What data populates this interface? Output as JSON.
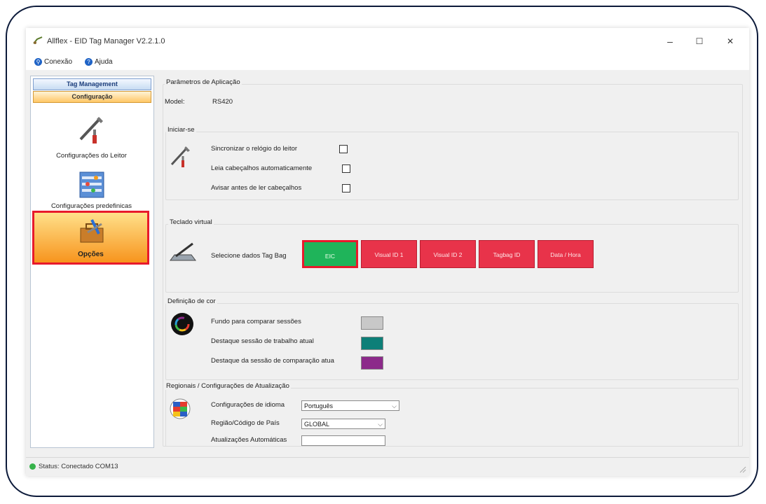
{
  "window": {
    "title": "Allflex - EID Tag Manager V2.2.1.0",
    "controls": {
      "minimize": "–",
      "maximize": "☐",
      "close": "✕"
    }
  },
  "menu": {
    "items": [
      "Conexão",
      "Ajuda"
    ]
  },
  "sidebar": {
    "tabs": [
      "Tag Management",
      "Configuração"
    ],
    "buttons": [
      "Configurações do Leitor",
      "Configurações predefinicas",
      "Opções"
    ],
    "selected": "Opções"
  },
  "params": {
    "legend": "Parâmetros de Aplicação",
    "model_label": "Model:",
    "model_value": "RS420"
  },
  "startup": {
    "legend": "Iniciar-se",
    "options": [
      {
        "label": "Sincronizar o relógio do leitor",
        "checked": false
      },
      {
        "label": "Leia cabeçalhos automaticamente",
        "checked": false
      },
      {
        "label": "Avisar antes de ler cabeçalhos",
        "checked": false
      }
    ]
  },
  "keyboard": {
    "legend": "Teclado virtual",
    "label": "Selecione dados Tag Bag",
    "buttons": [
      "EIC",
      "Visual ID 1",
      "Visual ID 2",
      "Tagbag ID",
      "Data / Hora"
    ],
    "selected": "EIC",
    "colors": {
      "button": "#e8334a",
      "selected": "#1fb45a",
      "highlight": "#e8192c"
    }
  },
  "colors": {
    "legend": "Definição de cor",
    "items": [
      {
        "label": "Fundo para comparar sessões",
        "color": "#c8c8c8"
      },
      {
        "label": "Destaque sessão de trabalho atual",
        "color": "#0d7f78"
      },
      {
        "label": "Destaque da sessão de comparação atua",
        "color": "#8c2a8a"
      }
    ]
  },
  "regional": {
    "legend": "Regionais / Configurações de Atualização",
    "language_label": "Configurações de idioma",
    "language_value": "Português",
    "region_label": "Região/Código de País",
    "region_value": "GLOBAL",
    "updates_label": "Atualizações Automáticas"
  },
  "status": {
    "text": "Status: Conectado  COM13"
  }
}
